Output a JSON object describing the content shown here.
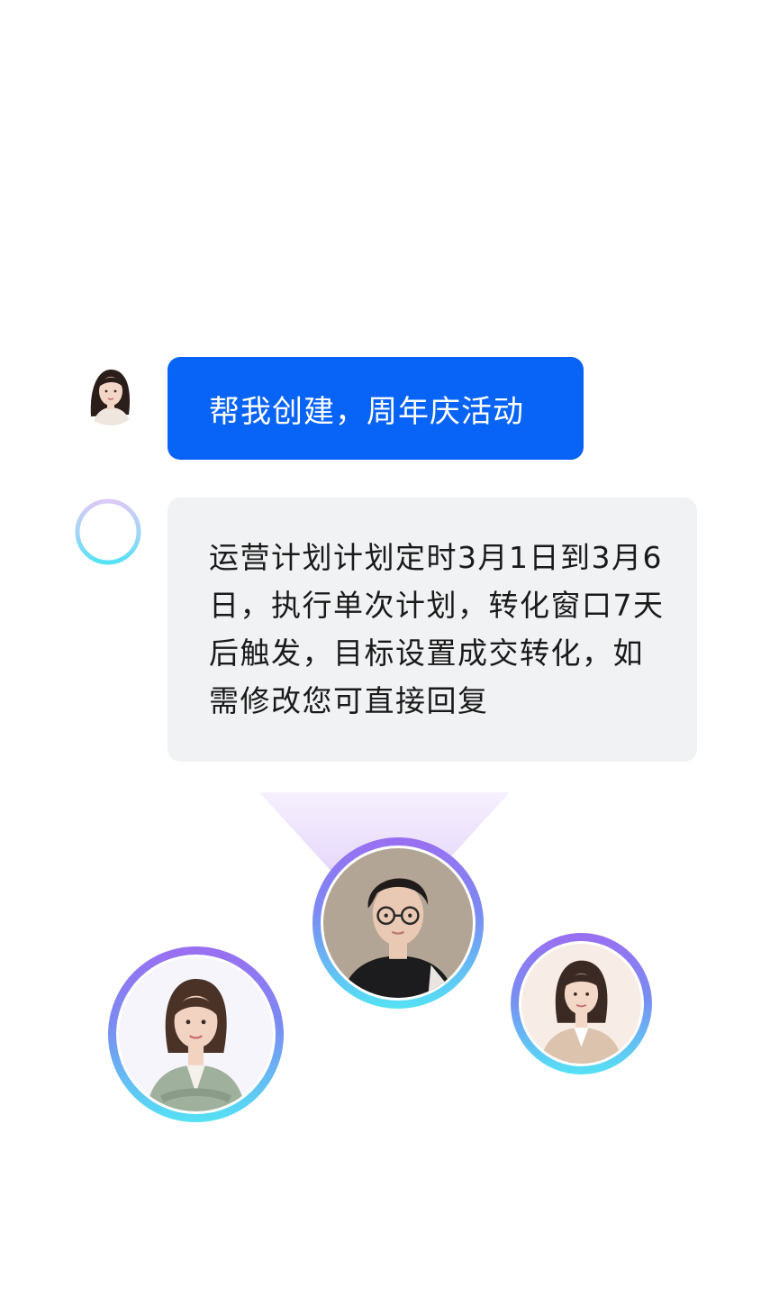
{
  "chat": {
    "user_message": "帮我创建，周年庆活动",
    "assistant_message": "运营计划计划定时3月1日到3月6日，执行单次计划，转化窗口7天后触发，目标设置成交转化，如需修改您可直接回复"
  },
  "colors": {
    "user_bubble": "#0863f7",
    "assistant_bubble": "#f1f2f4",
    "ring_gradient_top": "#9a6ef2",
    "ring_gradient_bottom": "#54e2f4"
  },
  "icons": {
    "user_avatar": "woman-portrait",
    "assistant_avatar": "gradient-ring-icon",
    "agents": [
      "man-with-glasses-portrait",
      "woman-green-blazer-portrait",
      "woman-beige-blazer-portrait"
    ]
  }
}
